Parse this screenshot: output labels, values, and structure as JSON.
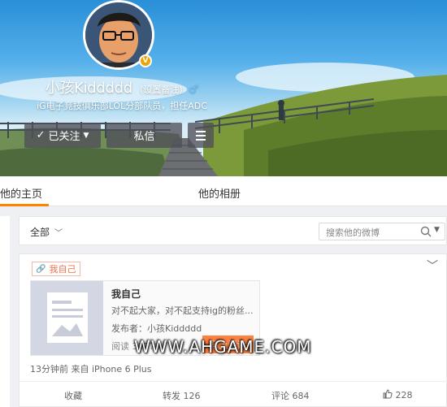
{
  "profile": {
    "nickname": "小孩Kiddddd",
    "remark_link": "(设置备注)",
    "gender_symbol": "♂",
    "verified_badge": "V",
    "bio": "iG电子竞技俱乐部LOL分部队员，担任ADC"
  },
  "buttons": {
    "follow_label": "已关注",
    "follow_check": "✓",
    "follow_caret": "▼",
    "message_label": "私信"
  },
  "tabs": {
    "home": "他的主页",
    "album": "他的相册"
  },
  "filter": {
    "all_label": "全部",
    "search_placeholder": "搜索他的微博"
  },
  "post": {
    "tag": "我自己",
    "article_title": "我自己",
    "article_desc": "对不起大家，对不起支持ig的粉丝...",
    "article_author": "发布者：小孩Kiddddd",
    "article_reads": "阅读 30778",
    "read_button": "马上阅读",
    "time_source": "13分钟前 来自 iPhone 6 Plus",
    "actions": {
      "favorite": "收藏",
      "repost": "转发 126",
      "comment": "评论 684",
      "like": "228"
    }
  },
  "watermark": "WWW.AHGAME.COM",
  "colors": {
    "accent": "#ff8200",
    "tag": "#eb7350",
    "read_button": "#ff8140"
  }
}
